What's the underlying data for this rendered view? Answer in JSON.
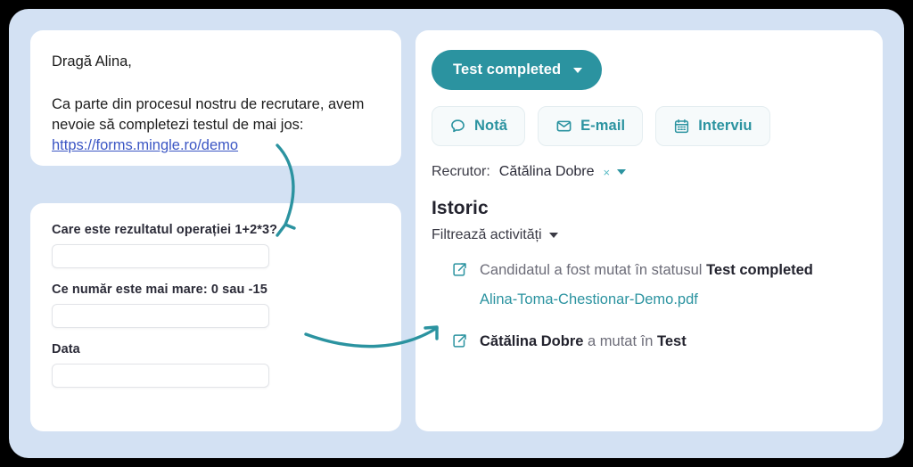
{
  "colors": {
    "page_background": "#000000",
    "panel_background": "#d3e1f3",
    "card_background": "#ffffff",
    "accent_teal": "#2b93a0",
    "link_blue": "#3b56c4",
    "text_dark": "#23232e",
    "text_muted": "#6c6c78"
  },
  "email_card": {
    "greeting": "Dragă Alina,",
    "body": "Ca parte din procesul nostru de recrutare, avem nevoie să completezi testul de mai jos:",
    "link": "https://forms.mingle.ro/demo"
  },
  "form_card": {
    "fields": [
      {
        "label": "Care este rezultatul operației 1+2*3?",
        "value": "",
        "placeholder": ""
      },
      {
        "label": "Ce număr este mai mare: 0 sau -15",
        "value": "",
        "placeholder": ""
      },
      {
        "label": "Data",
        "value": "",
        "placeholder": ""
      }
    ]
  },
  "detail_card": {
    "status_button": {
      "label": "Test completed",
      "icon": "chevron-down-icon"
    },
    "actions": [
      {
        "label": "Notă",
        "icon": "chat-bubble-icon"
      },
      {
        "label": "E-mail",
        "icon": "envelope-icon"
      },
      {
        "label": "Interviu",
        "icon": "calendar-icon"
      }
    ],
    "recruiter": {
      "label": "Recrutor:",
      "name": "Cătălina Dobre",
      "clear": "×",
      "caret_icon": "chevron-down-icon"
    },
    "history": {
      "title": "Istoric",
      "filter_label": "Filtrează activități",
      "filter_icon": "chevron-down-icon",
      "items": [
        {
          "icon": "share-move-icon",
          "text_prefix": "Candidatul a fost mutat în statusul ",
          "text_strong": "Test completed",
          "text_suffix": "",
          "file": "Alina-Toma-Chestionar-Demo.pdf"
        },
        {
          "icon": "share-move-icon",
          "text_prefix": "",
          "text_strong": "Cătălina Dobre",
          "text_middle": " a mutat în ",
          "text_strong2": "Test",
          "file": ""
        }
      ]
    }
  },
  "annotations": {
    "arrow_one": "curved-arrow-link-to-form",
    "arrow_two": "curved-arrow-form-to-history"
  }
}
